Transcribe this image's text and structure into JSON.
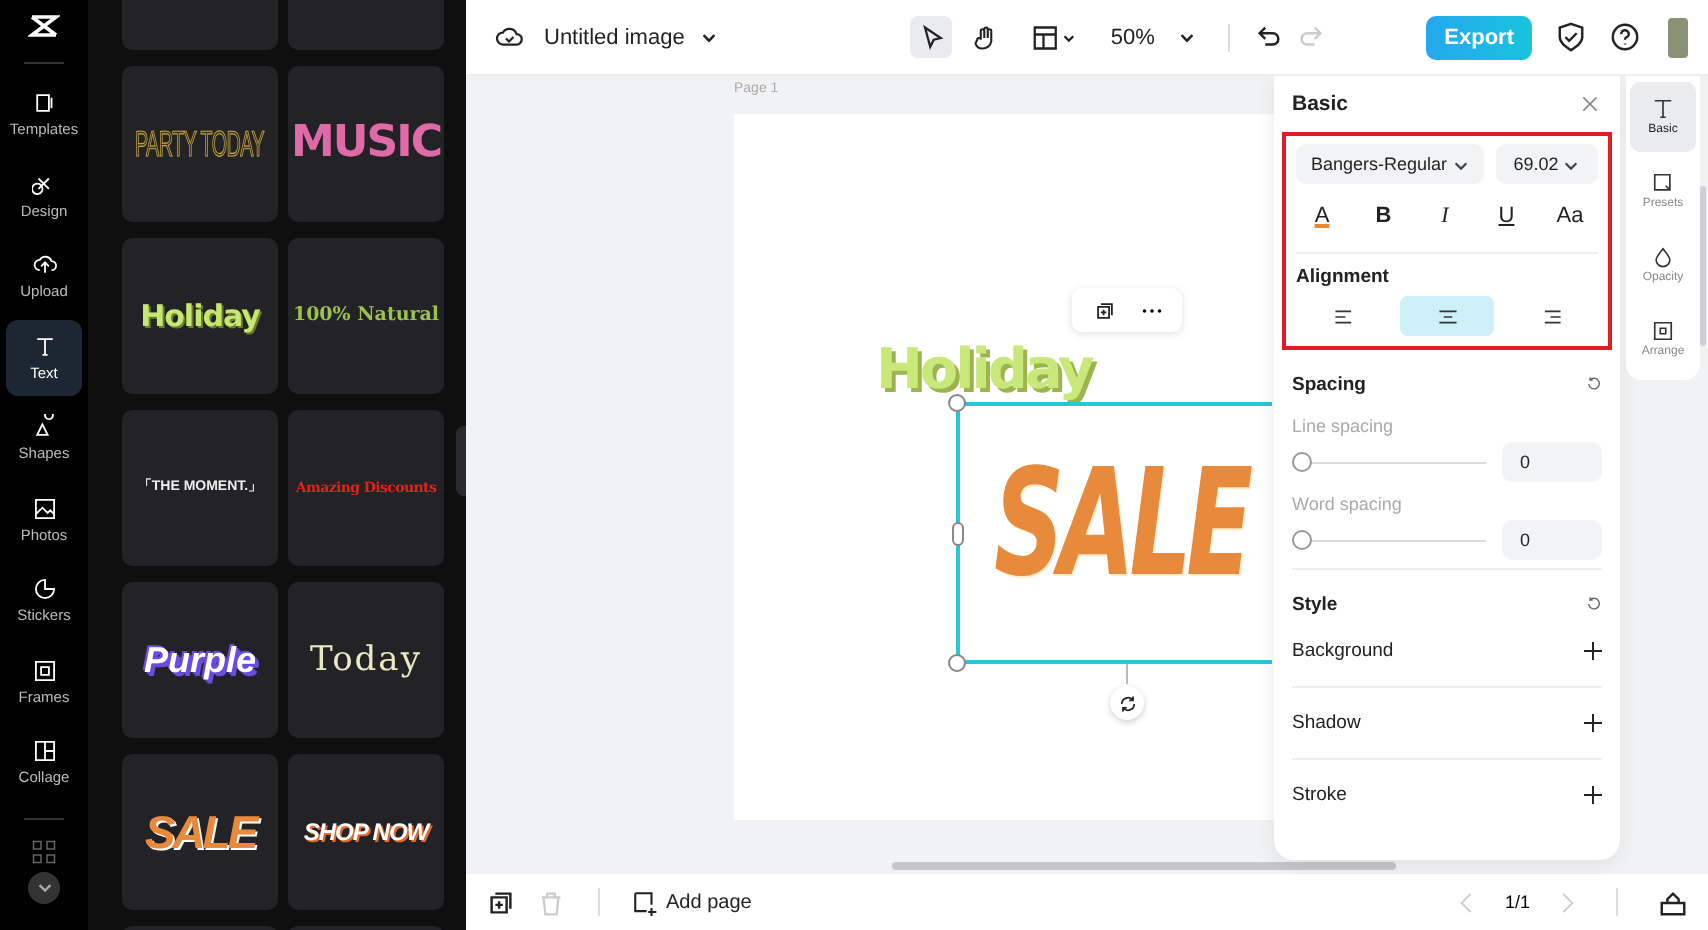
{
  "rail": [
    {
      "label": "Templates",
      "selected": false
    },
    {
      "label": "Design",
      "selected": false
    },
    {
      "label": "Upload",
      "selected": false
    },
    {
      "label": "Text",
      "selected": true
    },
    {
      "label": "Shapes",
      "selected": false
    },
    {
      "label": "Photos",
      "selected": false
    },
    {
      "label": "Stickers",
      "selected": false
    },
    {
      "label": "Frames",
      "selected": false
    },
    {
      "label": "Collage",
      "selected": false
    }
  ],
  "templates": [
    {
      "text": "PARTY TODAY",
      "kind": "party"
    },
    {
      "text": "MUSIC",
      "kind": "music"
    },
    {
      "text": "Holiday",
      "kind": "holiday"
    },
    {
      "text": "100% Natural",
      "kind": "natural"
    },
    {
      "text": "「THE MOMENT.」",
      "kind": "moment"
    },
    {
      "text": "Amazing Discounts",
      "kind": "discounts"
    },
    {
      "text": "Purple",
      "kind": "purple"
    },
    {
      "text": "Today",
      "kind": "today"
    },
    {
      "text": "SALE",
      "kind": "sale"
    },
    {
      "text": "SHOP NOW",
      "kind": "shop"
    }
  ],
  "topbar": {
    "title": "Untitled image",
    "tools": [
      {
        "kind": "pointer",
        "selected": true
      },
      {
        "kind": "hand",
        "selected": false
      }
    ],
    "zoom": "50%",
    "export": "Export"
  },
  "canvas": {
    "page_label": "Page 1",
    "texts": [
      {
        "text": "Holiday",
        "kind": "holiday"
      },
      {
        "text": "SALE",
        "kind": "sale"
      }
    ]
  },
  "panel": {
    "title": "Basic",
    "font": "Bangers-Regular",
    "size": "69.02",
    "format": [
      {
        "text": "A",
        "kind": "color"
      },
      {
        "text": "B",
        "kind": "bold"
      },
      {
        "text": "I",
        "kind": "italic"
      },
      {
        "text": "U",
        "kind": "underline"
      },
      {
        "text": "Aa",
        "kind": "case"
      }
    ],
    "alignment_label": "Alignment",
    "alignment": [
      {
        "kind": "left",
        "selected": false
      },
      {
        "kind": "center",
        "selected": true
      },
      {
        "kind": "right",
        "selected": false
      }
    ],
    "spacing_label": "Spacing",
    "sliders": [
      {
        "label": "Line spacing",
        "level": 0,
        "value": "0"
      },
      {
        "label": "Word spacing",
        "level": 0,
        "value": "0"
      }
    ],
    "style_label": "Style",
    "style_items": [
      "Background",
      "Shadow",
      "Stroke"
    ]
  },
  "side_tabs": [
    {
      "label": "Basic",
      "selected": true
    },
    {
      "label": "Presets",
      "selected": false
    },
    {
      "label": "Opacity",
      "selected": false
    },
    {
      "label": "Arrange",
      "selected": false
    }
  ],
  "bottom": {
    "add_page": "Add page",
    "pages": "1/1"
  }
}
